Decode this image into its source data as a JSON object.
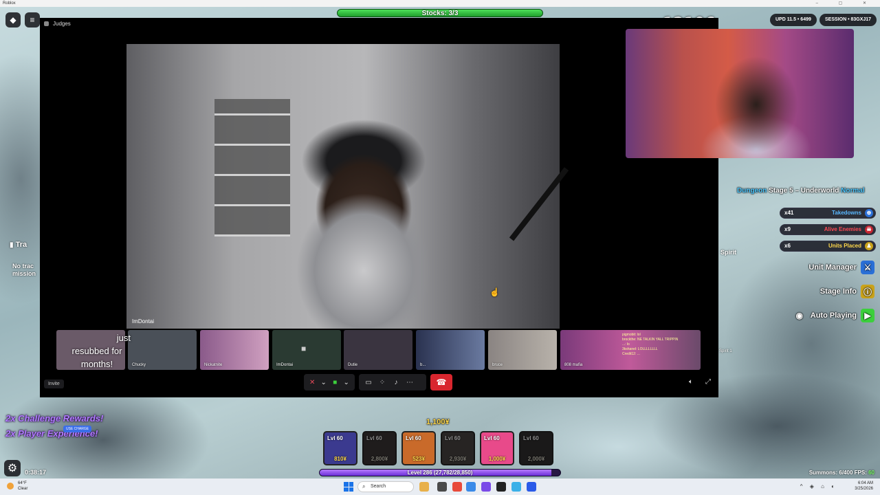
{
  "os": {
    "window_title": "Roblox",
    "window_controls": [
      "–",
      "▢",
      "✕"
    ]
  },
  "game_hud": {
    "stocks_label": "Stocks: 3/3",
    "counter": "12106",
    "upd_label": "UPD 11.5 • 6499",
    "session_label": "SESSION • 83GXJ17",
    "dungeon": {
      "prefix": "Dungeon",
      "stage": "Stage 5 – Underworld",
      "difficulty": "Normal"
    },
    "stats": [
      {
        "count": "x41",
        "label": "Takedowns",
        "color": "#5ab8ff",
        "icon": "crosshair-icon"
      },
      {
        "count": "x9",
        "label": "Alive Enemies",
        "color": "#ff4a55",
        "icon": "skull-icon"
      },
      {
        "count": "x6",
        "label": "Units Placed",
        "color": "#ffd84a",
        "icon": "unit-icon"
      }
    ],
    "side_buttons": {
      "unit_manager": "Unit Manager",
      "stage_info": "Stage Info",
      "auto_playing": "Auto Playing"
    },
    "spirit_label": "Spirit",
    "spirit_small": "Spirit 1",
    "quest_title": "Tra",
    "quest_sub": "No trac\nmission",
    "promos": [
      "2x Challenge Rewards!",
      "2x Player Experience!"
    ],
    "use_charge": "USE CHARGE",
    "timer": "0:38:17",
    "cash": "1,100¥",
    "hotbar": [
      {
        "level": "Lvl 60",
        "cost": "810¥",
        "dim": false,
        "color": "#3b3a8f"
      },
      {
        "level": "Lvl 60",
        "cost": "2,800¥",
        "dim": true,
        "color": "#5b2a2a"
      },
      {
        "level": "Lvl 60",
        "cost": "523¥",
        "dim": false,
        "color": "#c96a2a"
      },
      {
        "level": "Lvl 60",
        "cost": "2,930¥",
        "dim": true,
        "color": "#6a3a2a"
      },
      {
        "level": "Lvl 60",
        "cost": "1,000¥",
        "dim": false,
        "color": "#e84a8a"
      },
      {
        "level": "Lvl 60",
        "cost": "2,000¥",
        "dim": true,
        "color": "#3a2a2a"
      }
    ],
    "level_label": "Level 286 (27,782/28,850)",
    "level_progress": 0.963,
    "summons": "Summons: 6/400",
    "fps_label": "FPS:",
    "fps_value": "60"
  },
  "call": {
    "title": "Judges",
    "main_speaker": "ImDontai",
    "participants": [
      {
        "name": "",
        "color": "#6a5a68"
      },
      {
        "name": "Chucky",
        "color": "#4a5058"
      },
      {
        "name": "Nickatnite",
        "color": "#8a5a8a"
      },
      {
        "name": "ImDontai",
        "color": "#2a3a32"
      },
      {
        "name": "Dutie",
        "color": "#3a3440"
      },
      {
        "name": "b...",
        "color": "#2a3250"
      },
      {
        "name": "bruce",
        "color": "#6a6462"
      },
      {
        "name": "808 mafia",
        "color": "#7a3a7a"
      }
    ],
    "sub_alert": {
      "line1": "just",
      "line2": "resubbed for",
      "line3": "months!"
    },
    "tile_chat": [
      "pigmobit: lol",
      "brockthe: NE TALKIN YALL TRIPPIN",
      "...: lo",
      "3kshanel: LOLLLLLLLL",
      "Credit12: ..."
    ],
    "invite": "Invite"
  },
  "taskbar": {
    "weather_temp": "64°F",
    "weather_desc": "Clear",
    "search": "Search",
    "time": "6:04 AM",
    "date": "3/25/2026"
  }
}
